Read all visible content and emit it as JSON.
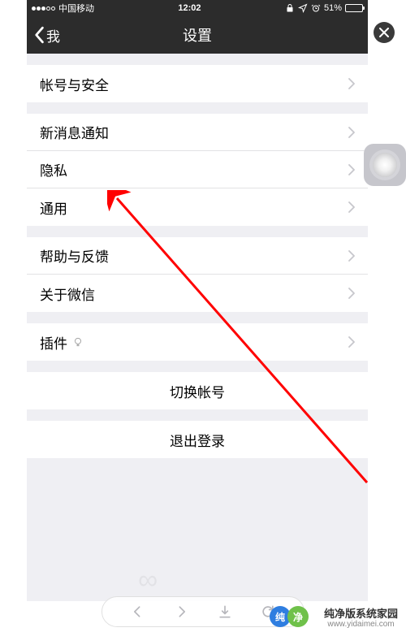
{
  "status": {
    "carrier": "中国移动",
    "time": "12:02",
    "battery_pct": "51%",
    "battery_fill_width": "51%"
  },
  "nav": {
    "back": "我",
    "title": "设置"
  },
  "groups": {
    "account": {
      "account_security": "帐号与安全"
    },
    "prefs": {
      "notifications": "新消息通知",
      "privacy": "隐私",
      "general": "通用"
    },
    "help": {
      "help_feedback": "帮助与反馈",
      "about": "关于微信"
    },
    "plugins": {
      "plugins": "插件"
    },
    "actions": {
      "switch_account": "切换帐号",
      "logout": "退出登录"
    }
  },
  "watermark": {
    "name": "纯净版系统家园",
    "url": "www.yidaimei.com"
  }
}
